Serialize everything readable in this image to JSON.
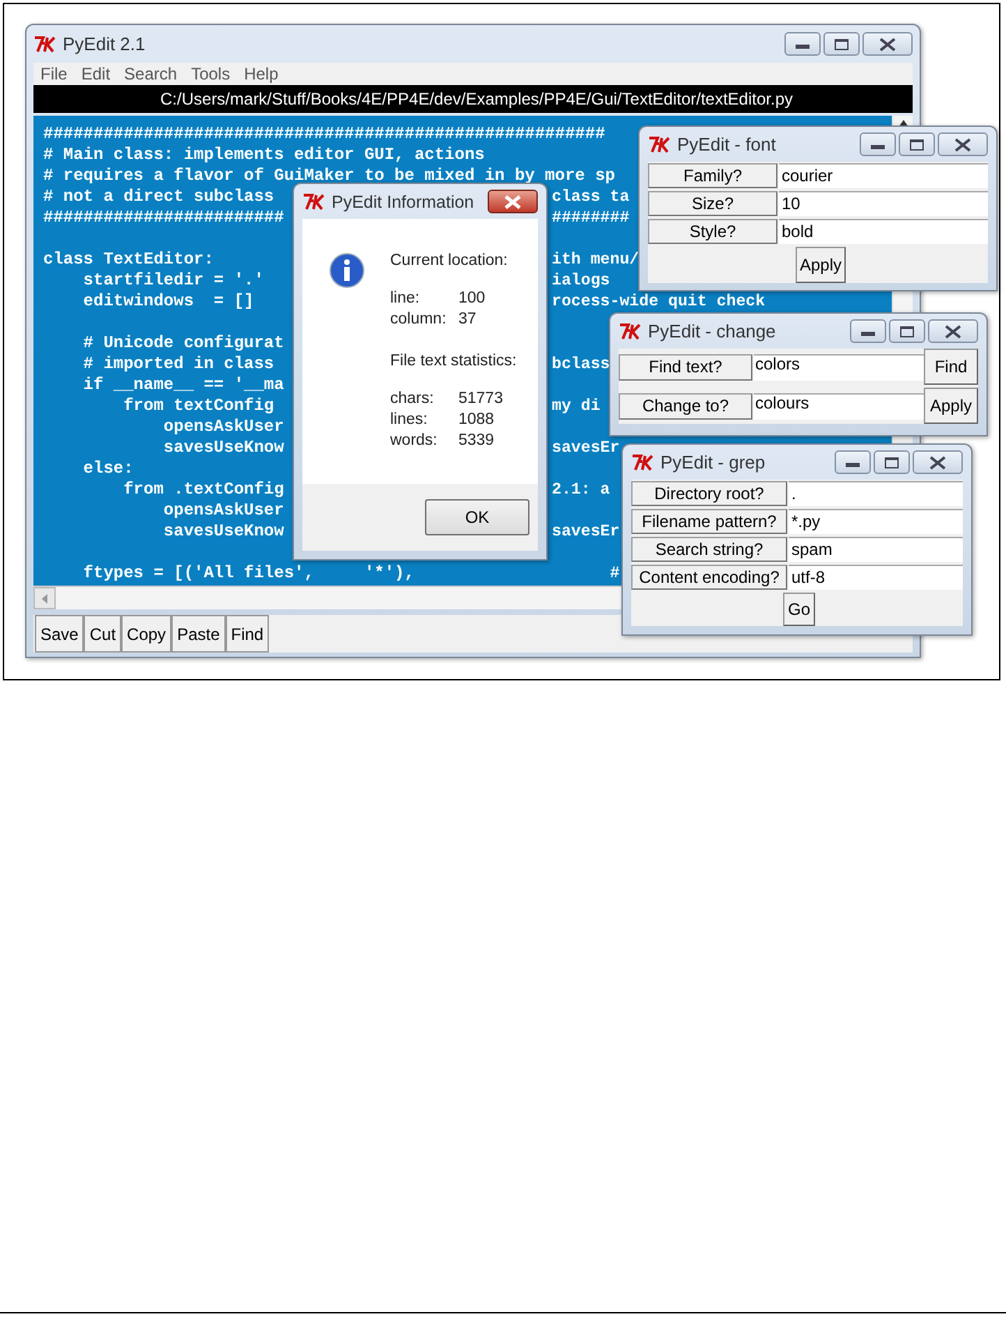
{
  "main_window": {
    "title": "PyEdit 2.1",
    "menu": [
      "File",
      "Edit",
      "Search",
      "Tools",
      "Help"
    ],
    "path": "C:/Users/mark/Stuff/Books/4E/PP4E/dev/Examples/PP4E/Gui/TextEditor/textEditor.py",
    "code_lines": [
      {
        "kind": "code",
        "left": "########################################################"
      },
      {
        "kind": "code",
        "left": "# Main class: implements editor GUI, actions"
      },
      {
        "kind": "code",
        "left": "# requires a flavor of GuiMaker to be mixed in by more sp"
      },
      {
        "kind": "code",
        "left": "# not a direct subclass",
        "right": "class ta"
      },
      {
        "kind": "code",
        "left": "########################",
        "right": "########"
      },
      {
        "kind": "blank"
      },
      {
        "kind": "code",
        "left": "class TextEditor:",
        "right": "ith menu/"
      },
      {
        "kind": "code",
        "left": "    startfiledir = '.'",
        "right": "ialogs"
      },
      {
        "kind": "code",
        "left": "    editwindows  = []",
        "right": "rocess-wide quit check"
      },
      {
        "kind": "blank"
      },
      {
        "kind": "code",
        "left": "    # Unicode configurat"
      },
      {
        "kind": "code",
        "left": "    # imported in class",
        "right": "bclass"
      },
      {
        "kind": "code",
        "left": "    if __name__ == '__ma"
      },
      {
        "kind": "code",
        "left": "        from textConfig",
        "right": "my di"
      },
      {
        "kind": "code",
        "left": "            opensAskUser"
      },
      {
        "kind": "code",
        "left": "            savesUseKnow",
        "right": "savesEr"
      },
      {
        "kind": "code",
        "left": "    else:"
      },
      {
        "kind": "code",
        "left": "        from .textConfig",
        "right": "2.1: a"
      },
      {
        "kind": "code",
        "left": "            opensAskUser"
      },
      {
        "kind": "code",
        "left": "            savesUseKnow",
        "right": "savesEr"
      },
      {
        "kind": "blank"
      },
      {
        "kind": "code",
        "left": "    ftypes = [('All files',     '*'),",
        "right": "      #"
      }
    ],
    "toolbar": [
      "Save",
      "Cut",
      "Copy",
      "Paste",
      "Find"
    ]
  },
  "info_dialog": {
    "title": "PyEdit Information",
    "location_heading": "Current location:",
    "location": [
      {
        "label": "line:",
        "value": "100"
      },
      {
        "label": "column:",
        "value": "37"
      }
    ],
    "stats_heading": "File text statistics:",
    "stats": [
      {
        "label": "chars:",
        "value": "51773"
      },
      {
        "label": "lines:",
        "value": "1088"
      },
      {
        "label": "words:",
        "value": "5339"
      }
    ],
    "button": "OK"
  },
  "font_dialog": {
    "title": "PyEdit - font",
    "fields": [
      {
        "label": "Family?",
        "value": "courier"
      },
      {
        "label": "Size?",
        "value": "10"
      },
      {
        "label": "Style?",
        "value": "bold"
      }
    ],
    "button": "Apply"
  },
  "change_dialog": {
    "title": "PyEdit - change",
    "rows": [
      {
        "label": "Find text?",
        "value": "colors",
        "button": "Find"
      },
      {
        "label": "Change to?",
        "value": "colours",
        "button": "Apply"
      }
    ]
  },
  "grep_dialog": {
    "title": "PyEdit - grep",
    "fields": [
      {
        "label": "Directory root?",
        "value": "."
      },
      {
        "label": "Filename pattern?",
        "value": "*.py"
      },
      {
        "label": "Search string?",
        "value": "spam"
      },
      {
        "label": "Content encoding?",
        "value": "utf-8"
      }
    ],
    "button": "Go"
  }
}
